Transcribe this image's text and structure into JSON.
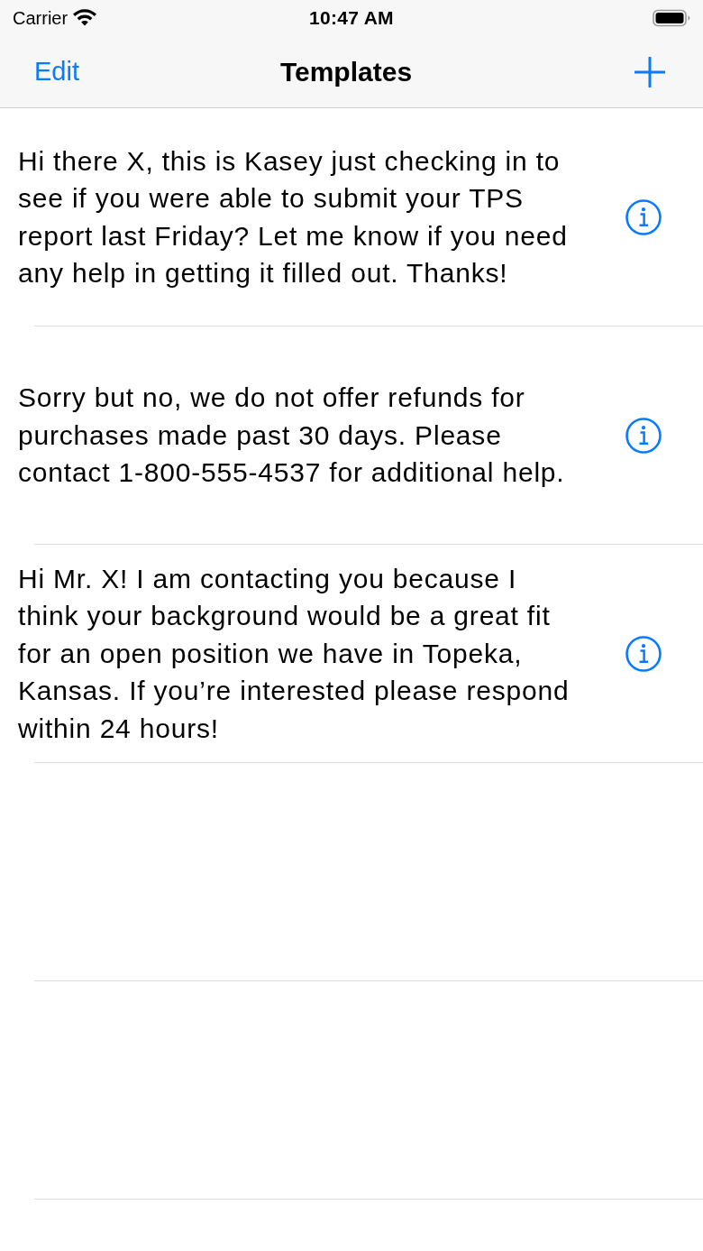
{
  "status_bar": {
    "carrier": "Carrier",
    "time": "10:47 AM"
  },
  "nav_bar": {
    "left_button": "Edit",
    "title": "Templates"
  },
  "templates": [
    {
      "text": "Hi there X, this is Kasey just checking in to see if you were able to submit your TPS report last Friday? Let me know if you need any help in getting it filled out. Thanks!"
    },
    {
      "text": "Sorry but no, we do not offer refunds for purchases made past 30 days. Please contact 1-800-555-4537 for additional help."
    },
    {
      "text": "Hi Mr. X! I am contacting you because I think your background would be a great fit for an open position we have in Topeka, Kansas. If you’re interested please respond within 24 hours!"
    }
  ]
}
